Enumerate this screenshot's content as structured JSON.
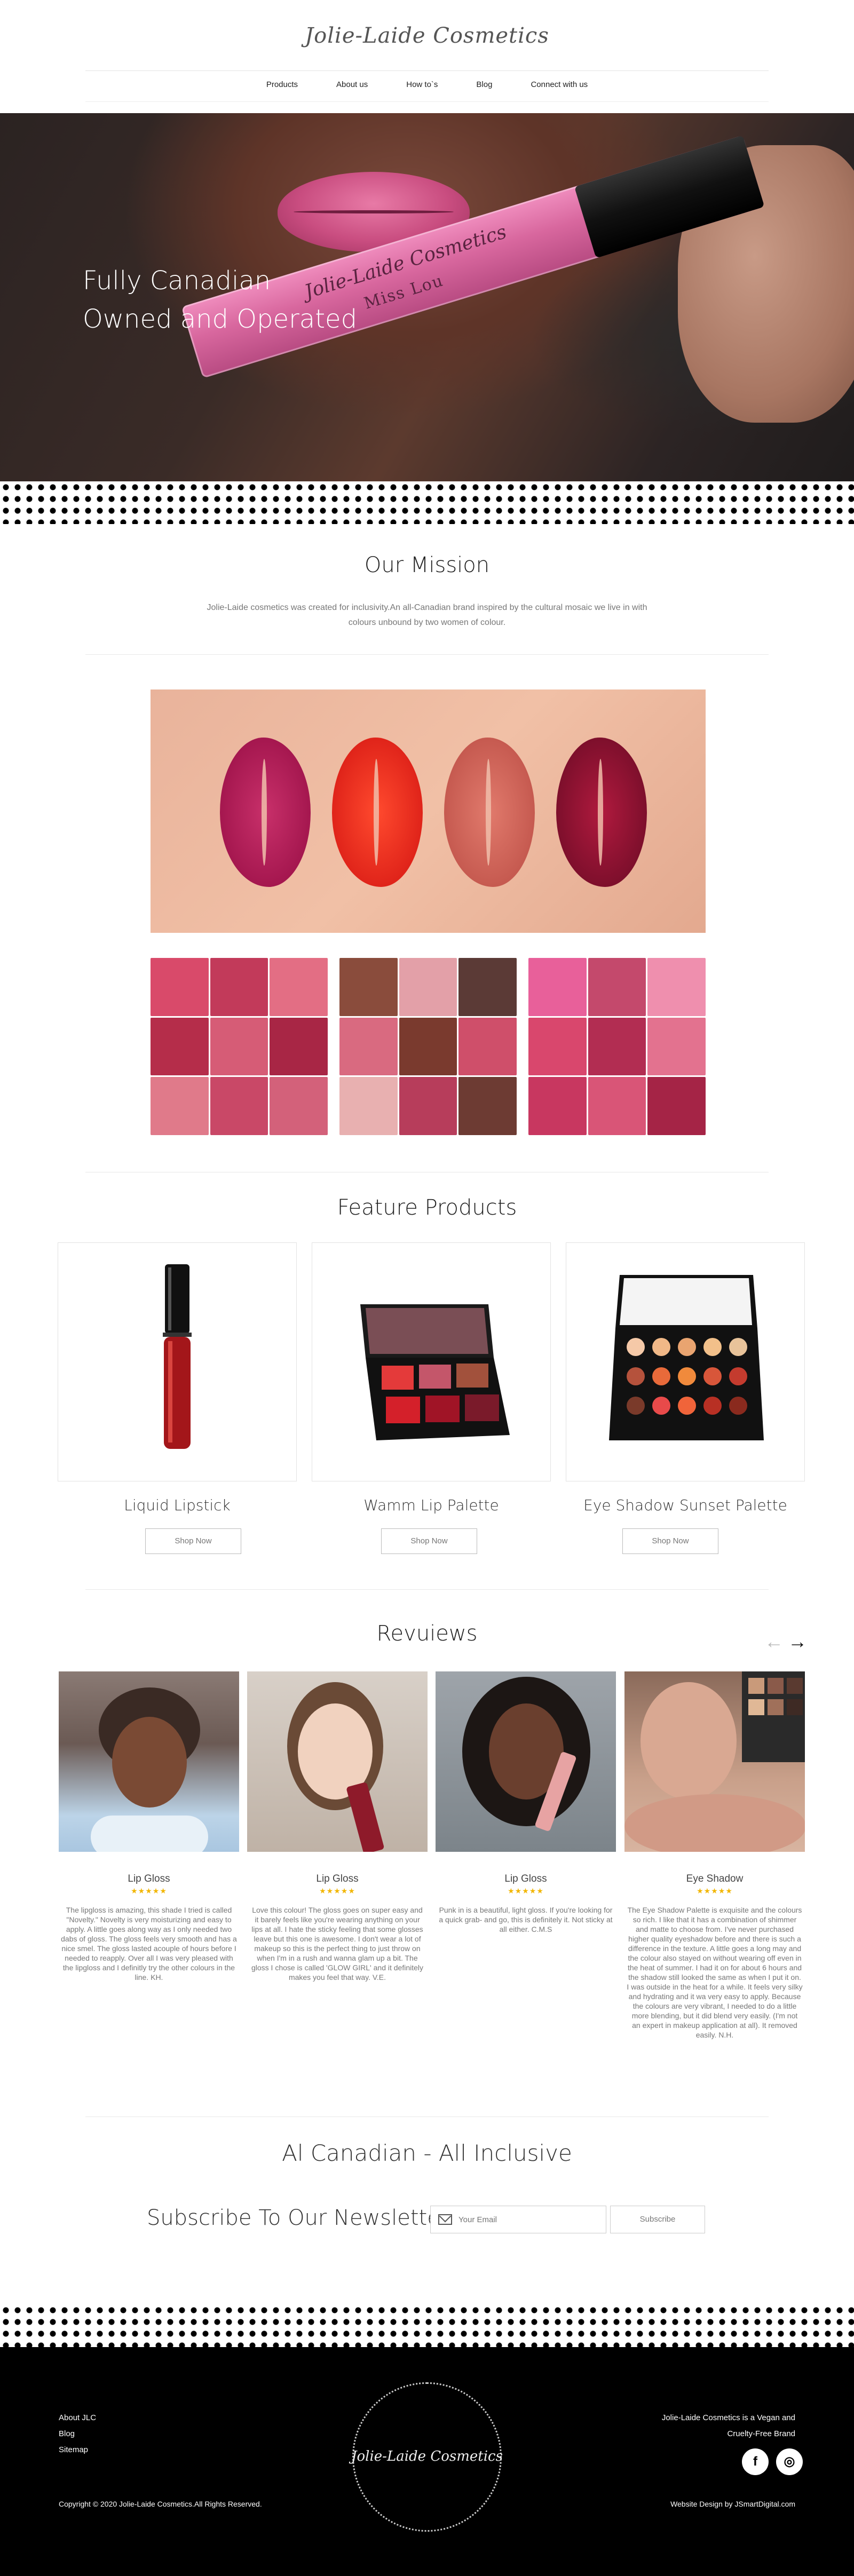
{
  "header": {
    "logo": "Jolie-Laide Cosmetics",
    "nav": [
      "Products",
      "About us",
      "How to`s",
      "Blog",
      "Connect with us"
    ]
  },
  "hero": {
    "title_line1": "Fully Canadian",
    "title_line2": "Owned and Operated",
    "product_brand": "Jolie-Laide Cosmetics",
    "product_shade": "Miss Lou"
  },
  "mission": {
    "title": "Our Mission",
    "text": "Jolie-Laide cosmetics was created for inclusivity.An all-Canadian brand inspired by the cultural mosaic we live in with colours unbound by two women of colour."
  },
  "features": {
    "title": "Feature Products",
    "products": [
      {
        "name": "Liquid Lipstick",
        "button": "Shop Now"
      },
      {
        "name": "Wamm Lip Palette",
        "button": "Shop Now"
      },
      {
        "name": "Eye Shadow Sunset Palette",
        "button": "Shop Now"
      }
    ]
  },
  "reviews": {
    "title": "Revuiews",
    "prev": "←",
    "next": "→",
    "items": [
      {
        "category": "Lip Gloss",
        "stars": "★★★★★",
        "text": "The lipgloss is amazing, this shade I tried is called \"Novelty.\" Novelty is very moisturizing and easy to apply. A little goes along way as I only needed two dabs of gloss. The gloss feels very smooth and has a nice smel. The gloss lasted acouple of hours before I needed to reapply. Over all I was very pleased with the lipgloss and I definitly try the other colours in the line. KH."
      },
      {
        "category": "Lip Gloss",
        "stars": "★★★★★",
        "text": "Love  this  colour! The gloss goes on super easy and it barely feels like you're wearing anything on your lips at all. I hate the sticky feeling that some glosses leave but this one is awesome. I don't wear a lot of makeup so this is the perfect thing to just throw on when I'm in a rush and wanna glam up a bit. The gloss I chose is called 'GLOW GIRL' and it definitely makes you feel that way. V.E."
      },
      {
        "category": "Lip Gloss",
        "stars": "★★★★★",
        "text": "Punk in is a beautiful, light gloss. If you're looking for a quick grab- and  go, this is definitely it. Not sticky at all either. C.M.S"
      },
      {
        "category": "Eye Shadow",
        "stars": "★★★★★",
        "text": "The Eye Shadow Palette is exquisite and the colours so rich. I like that it has a combination of shimmer and matte to choose from. I've never purchased higher quality eyeshadow before and there is such a difference in the texture. A little goes a long may and the colour also stayed on without wearing off even in the heat of summer. I had it on for about 6 hours and the shadow still looked the same as when I put it on. I was outside in the heat for a while. It feels very silky and hydrating and it wa very easy to apply. Because the colours are very vibrant, I needed to do a little more blending, but it did blend very easily. (I'm not an expert in makeup application at all). It removed easily. N.H."
      }
    ]
  },
  "newsletter": {
    "tagline": "Al Canadian - All Inclusive",
    "title": "Subscribe To Our Newsletter",
    "placeholder": "Your Email",
    "button": "Subscribe"
  },
  "footer": {
    "links": [
      "About JLC",
      "Blog",
      "Sitemap"
    ],
    "logo": "Jolie-Laide Cosmetics",
    "statement_line1": "Jolie-Laide Cosmetics is a Vegan and",
    "statement_line2": "Cruelty-Free Brand",
    "social": [
      "f",
      "◎"
    ],
    "copyright": "Copyright © 2020  Jolie-Laide Cosmetics.All Rights Reserved.",
    "credit": "Website Design by JSmartDigital.com"
  },
  "colors": {
    "accent_star": "#f2b600",
    "footer_bg": "#000000"
  }
}
